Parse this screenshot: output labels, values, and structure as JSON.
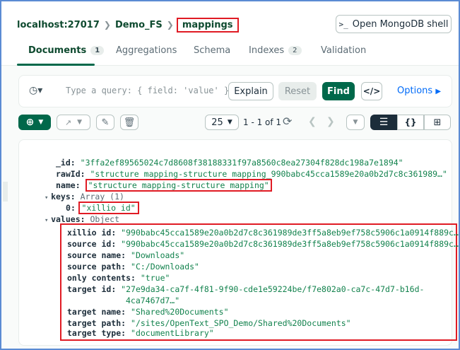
{
  "breadcrumb": {
    "host": "localhost:27017",
    "db": "Demo_FS",
    "collection": "mappings"
  },
  "shell_button": "Open MongoDB shell",
  "tabs": [
    {
      "label": "Documents",
      "badge": "1"
    },
    {
      "label": "Aggregations"
    },
    {
      "label": "Schema"
    },
    {
      "label": "Indexes",
      "badge": "2"
    },
    {
      "label": "Validation"
    }
  ],
  "query": {
    "placeholder": "Type a query: { field: 'value' }",
    "explain": "Explain",
    "reset": "Reset",
    "find": "Find",
    "options": "Options"
  },
  "pagination": {
    "page_size": "25",
    "range": "1 - 1 of 1"
  },
  "document": {
    "id_key": "_id",
    "id_value": "\"3ffa2ef89565024c7d8608f38188331f97a8560c8ea27304f828dc198a7e1894\"",
    "rawid_key": "rawId",
    "rawid_value": "\"structure mapping-structure mapping_990babc45cca1589e20a0b2d7c8c361989…\"",
    "name_key": "name",
    "name_value": "\"structure mapping-structure mapping\"",
    "keys_key": "keys",
    "keys_type": "Array (1)",
    "keys_index": "0",
    "keys_value": "\"xillio id\"",
    "values_key": "values",
    "values_type": "Object",
    "values_fields": [
      {
        "key": "xillio id",
        "value": "\"990babc45cca1589e20a0b2d7c8c361989de3ff5a8eb9ef758c5906c1a0914f889c…"
      },
      {
        "key": "source id",
        "value": "\"990babc45cca1589e20a0b2d7c8c361989de3ff5a8eb9ef758c5906c1a0914f889c…"
      },
      {
        "key": "source name",
        "value": "\"Downloads\""
      },
      {
        "key": "source path",
        "value": "\"C:/Downloads\""
      },
      {
        "key": "only contents",
        "value": "\"true\""
      },
      {
        "key": "target id",
        "value": "\"27e9da34-ca7f-4f81-9f90-cde1e59224be/f7e802a0-ca7c-47d7-b16d-",
        "value2": "4ca7467d7…\""
      },
      {
        "key": "target name",
        "value": "\"Shared%20Documents\""
      },
      {
        "key": "target path",
        "value": "\"/sites/OpenText_SPO_Demo/Shared%20Documents\""
      },
      {
        "key": "target type",
        "value": "\"documentLibrary\""
      }
    ]
  }
}
